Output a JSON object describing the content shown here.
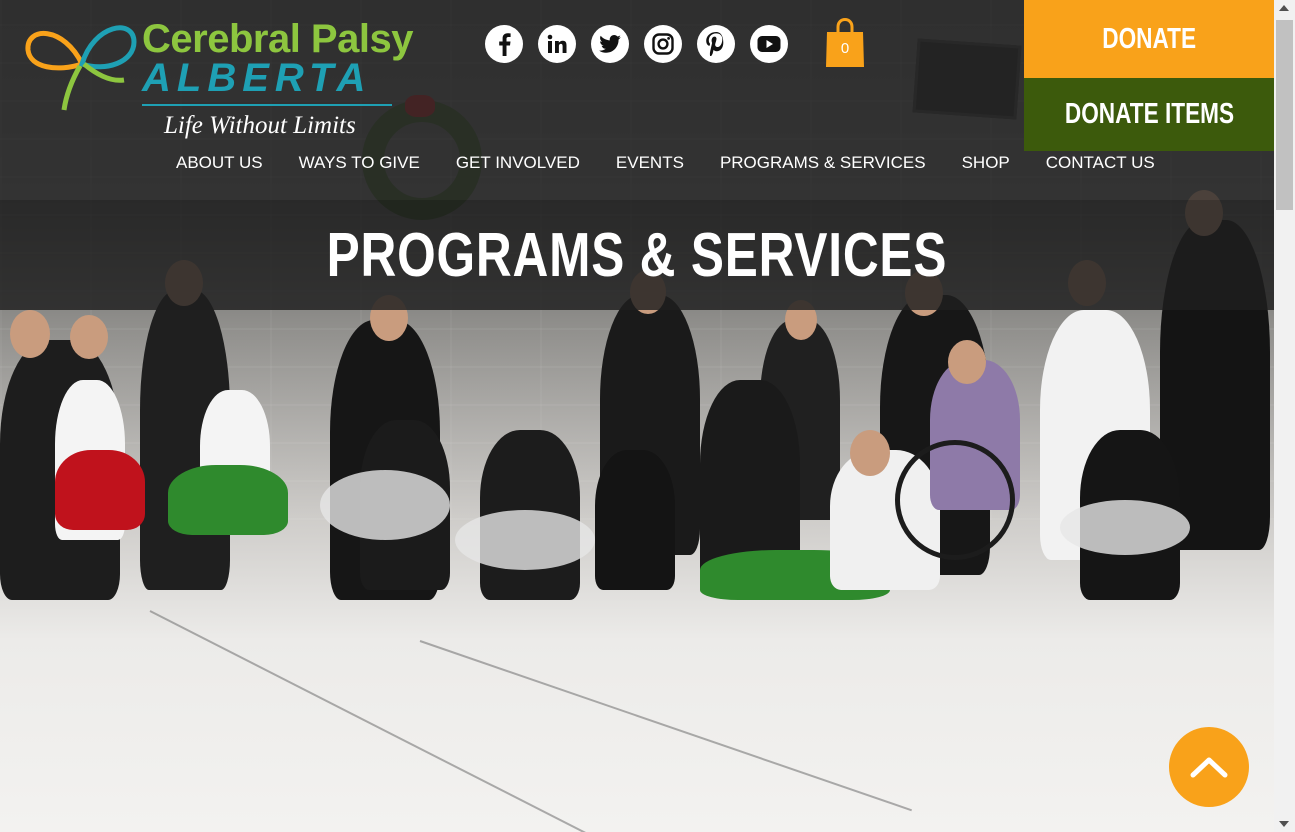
{
  "brand": {
    "name_line1": "Cerebral Palsy",
    "name_line2": "ALBERTA",
    "tagline": "Life Without Limits",
    "colors": {
      "green": "#8dc63f",
      "teal": "#1ea0b4",
      "orange": "#f9a21a",
      "dark_green": "#3c5a0c"
    }
  },
  "social": [
    {
      "name": "facebook-icon"
    },
    {
      "name": "linkedin-icon"
    },
    {
      "name": "twitter-icon"
    },
    {
      "name": "instagram-icon"
    },
    {
      "name": "pinterest-icon"
    },
    {
      "name": "youtube-icon"
    }
  ],
  "cart": {
    "count": "0"
  },
  "buttons": {
    "donate": "DONATE",
    "donate_items": "DONATE ITEMS"
  },
  "nav": [
    {
      "label": "ABOUT US"
    },
    {
      "label": "WAYS TO GIVE"
    },
    {
      "label": "GET INVOLVED"
    },
    {
      "label": "EVENTS"
    },
    {
      "label": "PROGRAMS & SERVICES"
    },
    {
      "label": "SHOP"
    },
    {
      "label": "CONTACT US"
    }
  ],
  "hero": {
    "title": "PROGRAMS & SERVICES"
  }
}
